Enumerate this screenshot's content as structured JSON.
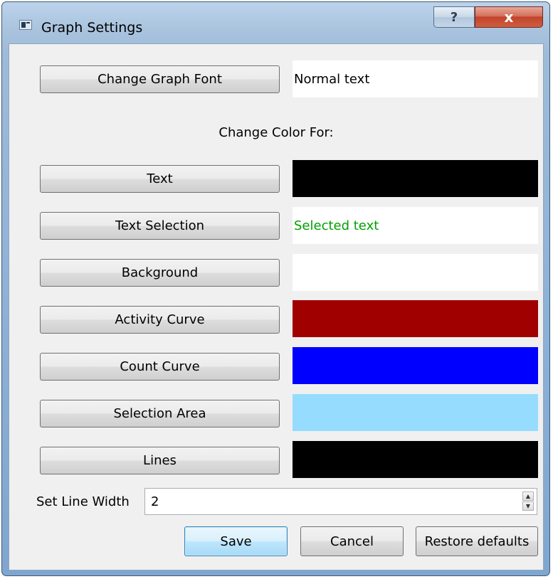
{
  "window": {
    "title": "Graph Settings",
    "help_label": "?",
    "close_label": "x"
  },
  "font": {
    "button_label": "Change Graph Font",
    "preview_text": "Normal text"
  },
  "section_label": "Change Color For:",
  "color_items": [
    {
      "label": "Text",
      "color": "#000000",
      "preview_text": ""
    },
    {
      "label": "Text Selection",
      "color": "#ffffff",
      "preview_text": "Selected text",
      "text_color": "#00a000"
    },
    {
      "label": "Background",
      "color": "#ffffff",
      "preview_text": ""
    },
    {
      "label": "Activity Curve",
      "color": "#a00000",
      "preview_text": ""
    },
    {
      "label": "Count Curve",
      "color": "#0000ff",
      "preview_text": ""
    },
    {
      "label": "Selection Area",
      "color": "#96dcff",
      "preview_text": ""
    },
    {
      "label": "Lines",
      "color": "#000000",
      "preview_text": ""
    }
  ],
  "line_width": {
    "label": "Set Line Width",
    "value": "2"
  },
  "buttons": {
    "save": "Save",
    "cancel": "Cancel",
    "restore": "Restore defaults"
  }
}
